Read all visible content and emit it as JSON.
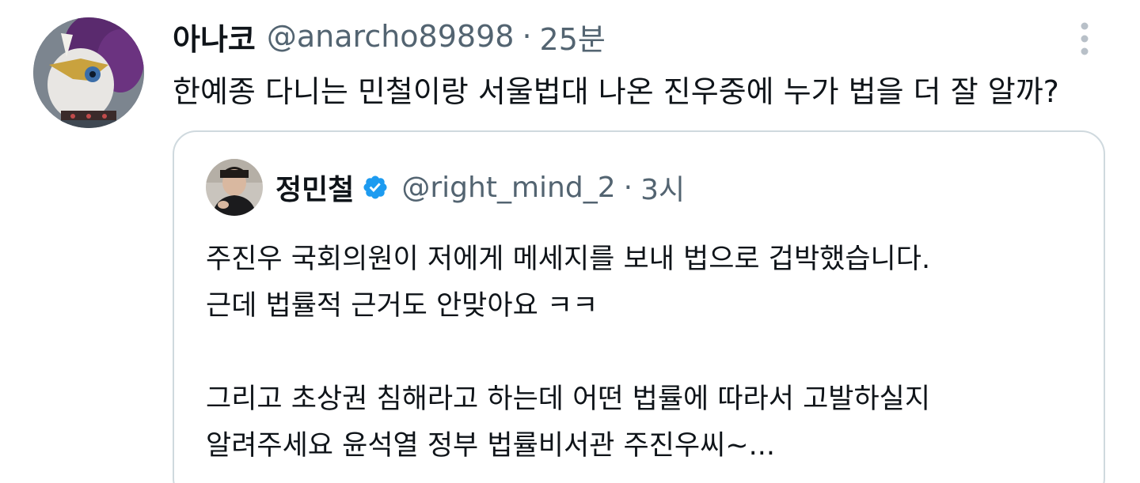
{
  "tweet": {
    "display_name": "아나코",
    "handle": "@anarcho89898",
    "separator": "·",
    "time": "25분",
    "text": "한예종 다니는 민철이랑 서울법대 나온 진우중에 누가 법을 더 잘 알까?",
    "more_icon": "more-vertical-icon"
  },
  "quote": {
    "display_name": "정민철",
    "verified_icon": "verified-badge-icon",
    "verified_color": "#1d9bf0",
    "handle": "@right_mind_2",
    "separator": "·",
    "time": "3시",
    "lines": [
      "주진우 국회의원이 저에게 메세지를 보내 법으로 겁박했습니다.",
      "근데 법률적 근거도 안맞아요 ㅋㅋ",
      "",
      "그리고 초상권 침해라고 하는데 어떤 법률에 따라서 고발하실지",
      "알려주세요 윤석열 정부 법률비서관 주진우씨~..."
    ]
  },
  "colors": {
    "text_primary": "#0f1419",
    "text_secondary": "#536471",
    "border": "#cfd9de"
  }
}
